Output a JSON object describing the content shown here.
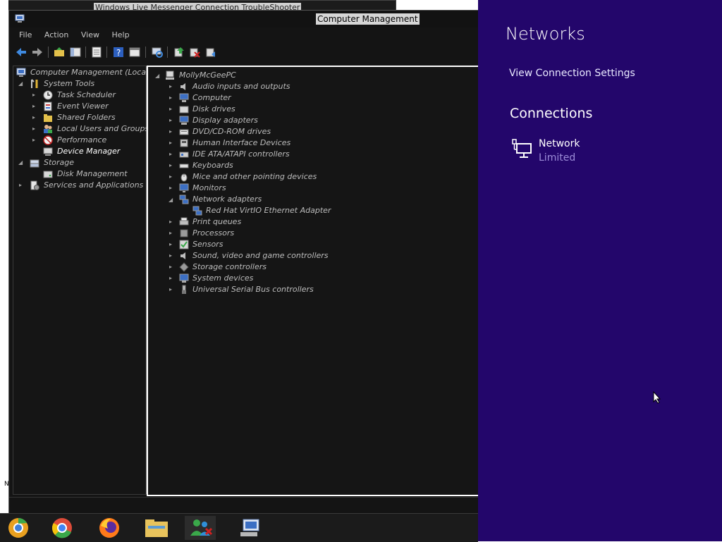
{
  "background_window": {
    "title": "Windows Live Messenger Connection TroubleShooter"
  },
  "window": {
    "title": "Computer Management",
    "menu": [
      "File",
      "Action",
      "View",
      "Help"
    ]
  },
  "left_tree": [
    {
      "label": "Computer Management (Local)"
    },
    {
      "label": "System Tools"
    },
    {
      "label": "Task Scheduler"
    },
    {
      "label": "Event Viewer"
    },
    {
      "label": "Shared Folders"
    },
    {
      "label": "Local Users and Groups"
    },
    {
      "label": "Performance"
    },
    {
      "label": "Device Manager"
    },
    {
      "label": "Storage"
    },
    {
      "label": "Disk Management"
    },
    {
      "label": "Services and Applications"
    }
  ],
  "device_tree": {
    "root": "MollyMcGeePC",
    "items": [
      "Audio inputs and outputs",
      "Computer",
      "Disk drives",
      "Display adapters",
      "DVD/CD-ROM drives",
      "Human Interface Devices",
      "IDE ATA/ATAPI controllers",
      "Keyboards",
      "Mice and other pointing devices",
      "Monitors",
      "Network adapters",
      "Red Hat VirtIO Ethernet Adapter",
      "Print queues",
      "Processors",
      "Sensors",
      "Sound, video and game controllers",
      "Storage controllers",
      "System devices",
      "Universal Serial Bus controllers"
    ]
  },
  "charm": {
    "title": "Networks",
    "view_settings": "View Connection Settings",
    "connections_heading": "Connections",
    "network_name": "Network",
    "network_status": "Limited",
    "bg_color": "#23066b"
  }
}
